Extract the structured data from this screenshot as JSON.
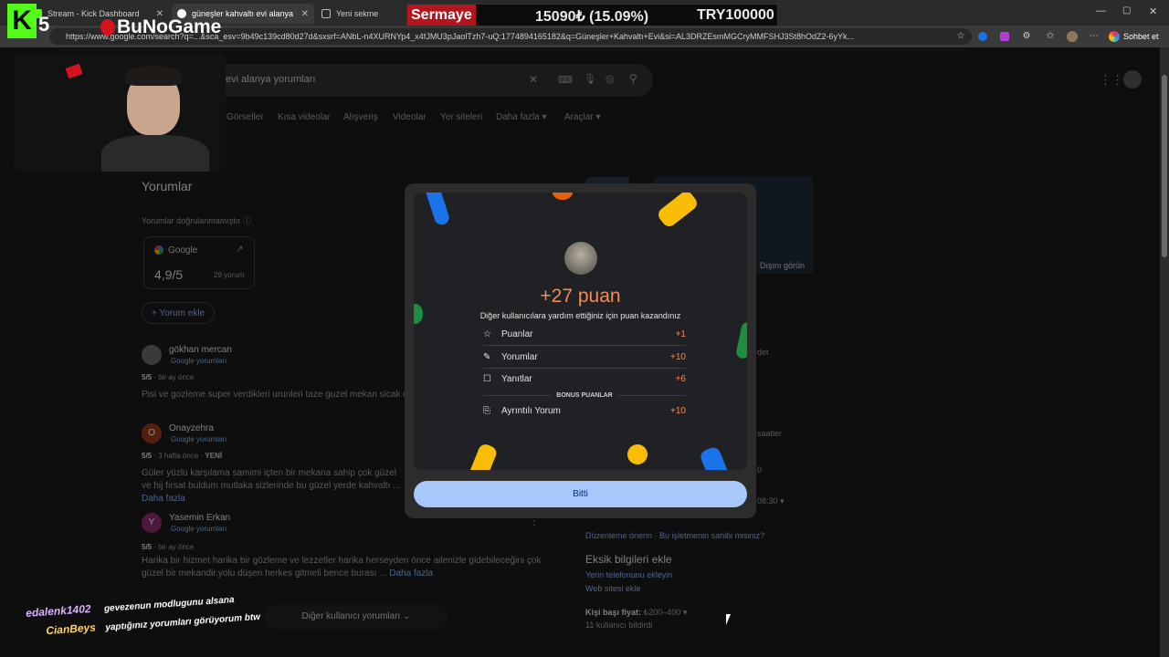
{
  "tabs": [
    {
      "title": "Stream - Kick Dashboard",
      "active": false
    },
    {
      "title": "güneşler kahvaltı evi alanya yorum",
      "active": true
    },
    {
      "title": "Yeni sekme",
      "active": false
    }
  ],
  "address": {
    "url": "https://www.google.com/search?q=...&sca_esv=9b49c139cd80d27d&sxsrf=ANbL-n4XURNYp4_x4fJMU3pJaolTzh7-uQ:1774894165182&q=Güneşler+Kahvaltı+Evi&si=AL3DRZEsmMGCryMMFSHJ3St8hOdZ2-6yYk...",
    "profile_label": "Sohbet et"
  },
  "overlay": {
    "sermaye_label": "Sermaye",
    "sermaye_value": "15090₺ (15.09%)",
    "try_value": "TRY100000",
    "brand": "BuNoGame",
    "kick_num": "5"
  },
  "search": {
    "query": "evi alanya yorumları",
    "tabs": [
      "Görseller",
      "Kısa videolar",
      "Alışveriş",
      "Videolar",
      "Yer siteleri",
      "Daha fazla",
      "Araçlar"
    ]
  },
  "reviews_panel": {
    "heading": "Yorumlar",
    "unverified": "Yorumlar doğrulanmamıştır",
    "google_label": "Google",
    "rating": "4,9/5",
    "count": "29 yorum",
    "add_review": "Yorum ekle",
    "items": [
      {
        "avatar": "",
        "name": "gökhan mercan",
        "source": "Google yorumları",
        "score": "5/5",
        "when": "bir ay önce",
        "badge": "",
        "text": "Pisi ve gozleme super verdikleri urunleri taze guzel mekan sicak ortan",
        "more": ""
      },
      {
        "avatar": "O",
        "name": "Onayzehra",
        "source": "Google yorumları",
        "score": "5/5",
        "when": "3 hafta önce",
        "badge": "YENİ",
        "text": "Güler yüzlü karşılama samimi içten bir mekana sahip çok güzel ve hij fırsat buldum mutlaka sizlerinde bu güzel yerde kahvaltı ...",
        "more": "Daha fazla"
      },
      {
        "avatar": "Y",
        "name": "Yasemin Erkan",
        "source": "Google yorumları",
        "score": "5/5",
        "when": "bir ay önce",
        "badge": "",
        "text": "Harika bir hizmet harika bir gözleme ve lezzetler harika herseyden önce ailenizle gidebileceğini çok güzel bir mekandir.yolu düşen herkes gitmeli bence burası ...",
        "more": "Daha fazla"
      }
    ],
    "other_reviews": "Diğer kullanıcı yorumları"
  },
  "right_panel": {
    "outside_view": "Dışını görün",
    "partial1": "det",
    "partial2": "saatler",
    "partial3": "0",
    "time": "08:30",
    "suggest_edit": "Düzenleme önerin",
    "own_business": "Bu işletmenin sahibi misiniz?",
    "missing_title": "Eksik bilgileri ekle",
    "add_phone": "Yerin telefonunu ekleyin",
    "add_website": "Web sitesi ekle",
    "price_label": "Kişi başı fiyat:",
    "price_value": "₺200–400",
    "price_users": "11 kullanıcı bildirdi"
  },
  "modal": {
    "points_title": "+27 puan",
    "subtitle": "Diğer kullanıcılara yardım ettiğiniz için puan kazandınız",
    "rows": [
      {
        "icon": "star-icon",
        "label": "Puanlar",
        "points": "+1"
      },
      {
        "icon": "review-icon",
        "label": "Yorumlar",
        "points": "+10"
      },
      {
        "icon": "reply-icon",
        "label": "Yanıtlar",
        "points": "+6"
      }
    ],
    "bonus_label": "BONUS PUANLAR",
    "bonus_row": {
      "icon": "gift-icon",
      "label": "Ayrıntılı Yorum",
      "points": "+10"
    },
    "done_label": "Bitti"
  },
  "chat": [
    {
      "user": "edalenk1402",
      "message": "gevezenun modlugunu alsana"
    },
    {
      "user": "CianBeys",
      "message": "yaptığınız yorumları görüyorum btw"
    }
  ],
  "colors": {
    "accent_orange": "#f28b54",
    "link_blue": "#8ab4f8",
    "button_blue": "#a8c7fa",
    "sermaye_red": "#b3141e"
  }
}
